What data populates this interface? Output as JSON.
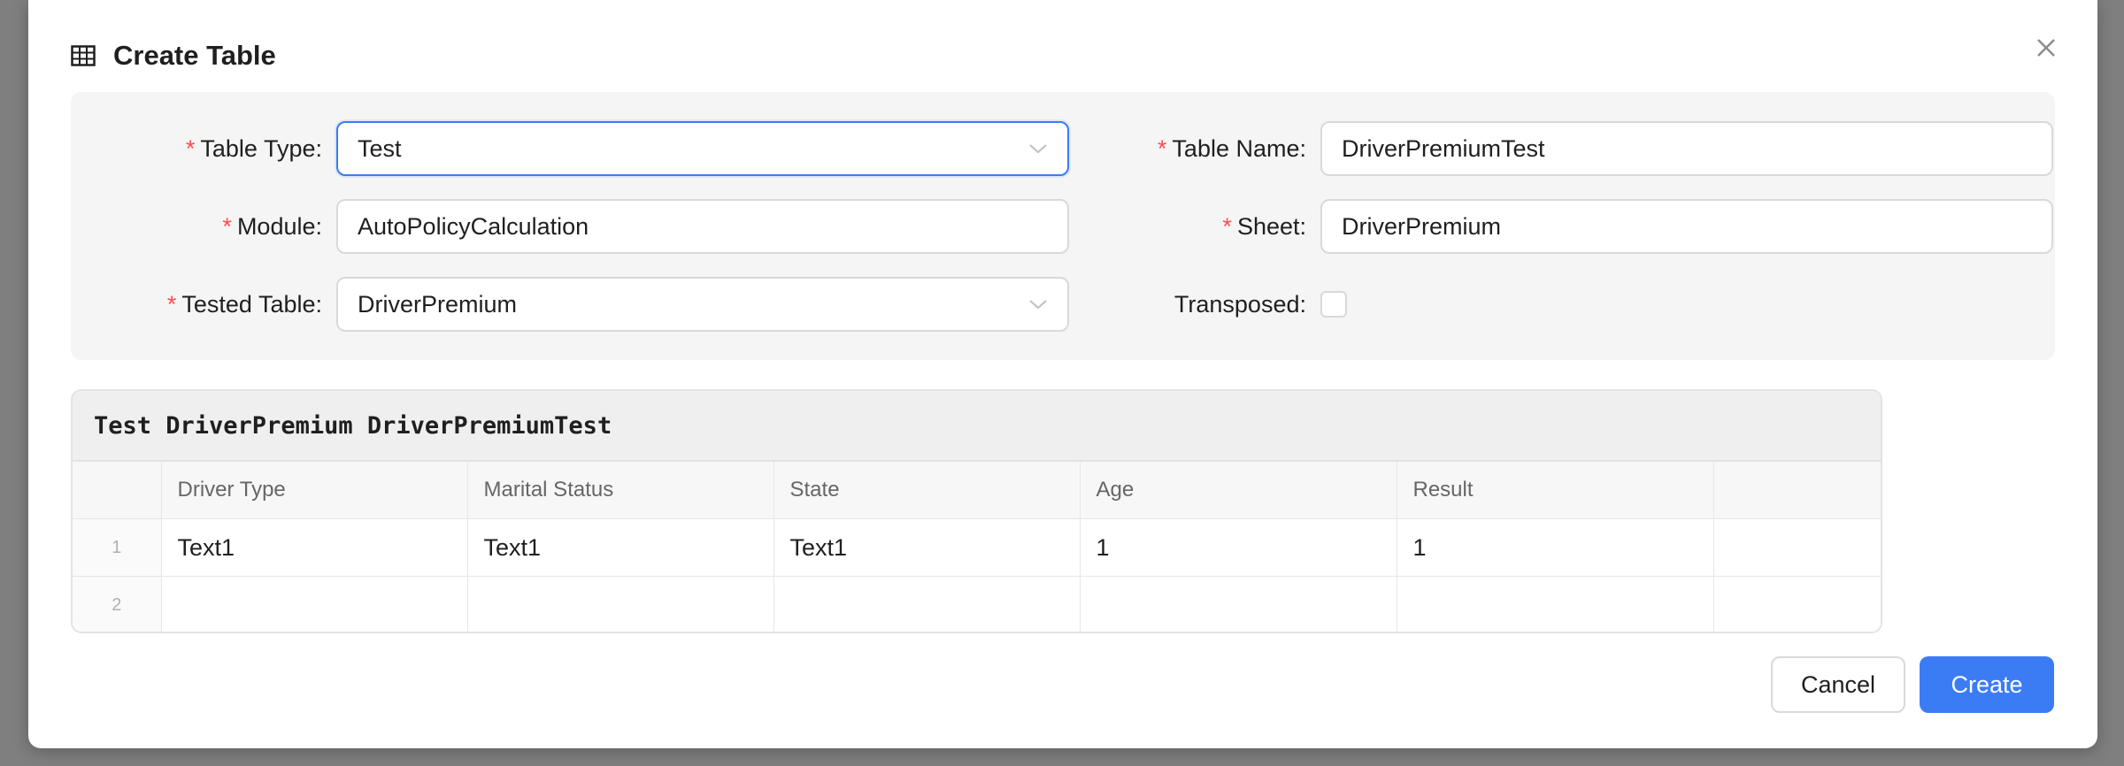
{
  "dialog": {
    "title": "Create Table",
    "icon": "table-icon",
    "close_icon": "close-icon"
  },
  "form": {
    "table_type": {
      "label": "Table Type:",
      "value": "Test",
      "required": "*"
    },
    "table_name": {
      "label": "Table Name:",
      "value": "DriverPremiumTest",
      "required": "*"
    },
    "module": {
      "label": "Module:",
      "value": "AutoPolicyCalculation",
      "required": "*"
    },
    "sheet": {
      "label": "Sheet:",
      "value": "DriverPremium",
      "required": "*"
    },
    "tested_table": {
      "label": "Tested Table:",
      "value": "DriverPremium",
      "required": "*"
    },
    "transposed": {
      "label": "Transposed:",
      "checked": false
    }
  },
  "preview": {
    "title": "Test DriverPremium DriverPremiumTest",
    "columns": [
      "Driver Type",
      "Marital Status",
      "State",
      "Age",
      "Result",
      ""
    ],
    "rows": [
      {
        "num": "1",
        "cells": [
          "Text1",
          "Text1",
          "Text1",
          "1",
          "1",
          ""
        ]
      },
      {
        "num": "2",
        "cells": [
          "",
          "",
          "",
          "",
          "",
          ""
        ]
      }
    ]
  },
  "actions": {
    "cancel": "Cancel",
    "create": "Create"
  },
  "colors": {
    "accent": "#3b7cf4",
    "required": "#ff4d4f"
  }
}
